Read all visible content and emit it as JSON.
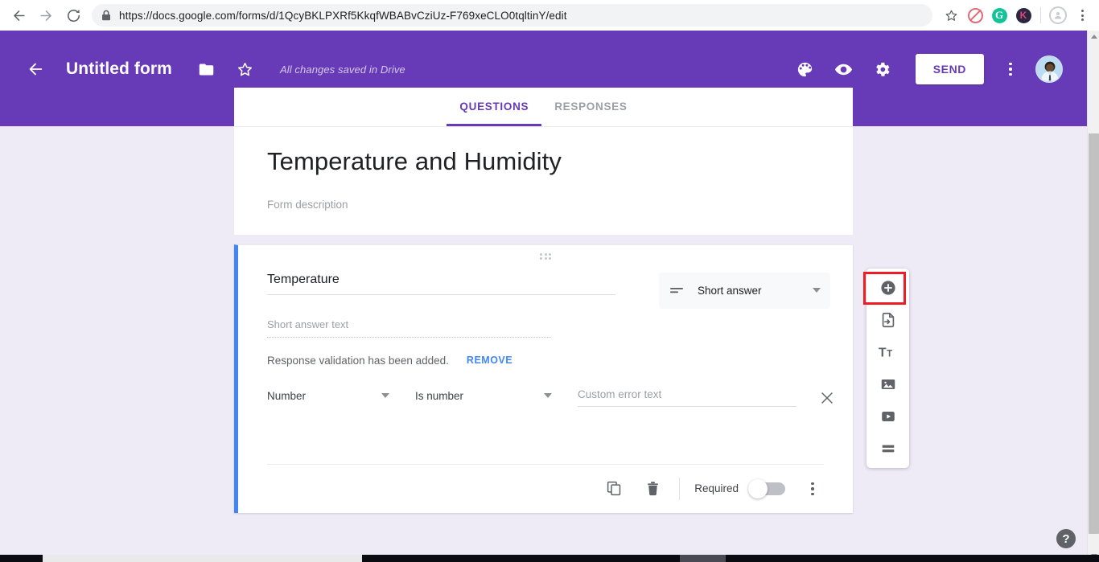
{
  "browser": {
    "url": "https://docs.google.com/forms/d/1QcyBKLPXRf5KkqfWBABvCziUz-F769xeCLO0tqltinY/edit",
    "url_domain": "docs.google.com",
    "url_path": "/forms/d/1QcyBKLPXRf5KkqfWBABvCziUz-F769xeCLO0tqltinY/edit",
    "back_icon": "back-arrow-icon",
    "forward_icon": "forward-arrow-icon",
    "reload_icon": "reload-icon",
    "lock_icon": "lock-icon",
    "bookmark_icon": "star-icon",
    "extensions": [
      {
        "name": "adblock-extension-icon",
        "label": ""
      },
      {
        "name": "grammarly-extension-icon",
        "label": "G"
      },
      {
        "name": "kami-extension-icon",
        "label": "K"
      }
    ],
    "profile_icon": "profile-icon",
    "menu_icon": "browser-menu-icon"
  },
  "header": {
    "back_icon": "back-arrow-icon",
    "title": "Untitled form",
    "folder_icon": "folder-icon",
    "star_icon": "star-icon",
    "save_status": "All changes saved in Drive",
    "theme_icon": "palette-icon",
    "preview_icon": "eye-icon",
    "settings_icon": "gear-icon",
    "send_label": "SEND",
    "more_icon": "more-vert-icon",
    "avatar": "user-avatar",
    "bg_color": "#673ab7"
  },
  "tabs": [
    {
      "label": "QUESTIONS",
      "active": true
    },
    {
      "label": "RESPONSES",
      "active": false
    }
  ],
  "form": {
    "title": "Temperature and Humidity",
    "description_placeholder": "Form description"
  },
  "question": {
    "drag_handle_icon": "drag-handle-icon",
    "title": "Temperature",
    "answer_placeholder": "Short answer text",
    "type_icon": "short-answer-icon",
    "type_label": "Short answer",
    "type_caret_icon": "chevron-down-icon",
    "validation": {
      "note": "Response validation has been added.",
      "remove_label": "REMOVE",
      "remove_color": "#4285f4",
      "criteria_type": "Number",
      "criteria_rule": "Is number",
      "error_placeholder": "Custom error text",
      "close_icon": "close-icon"
    },
    "footer": {
      "duplicate_icon": "duplicate-icon",
      "delete_icon": "trash-icon",
      "required_label": "Required",
      "required_on": false,
      "more_icon": "more-vert-icon"
    },
    "accent_color": "#4285f4"
  },
  "side_toolbar": {
    "items": [
      {
        "icon": "add-question-icon",
        "highlighted": true
      },
      {
        "icon": "import-questions-icon",
        "highlighted": false
      },
      {
        "icon": "add-title-description-icon",
        "highlighted": false
      },
      {
        "icon": "add-image-icon",
        "highlighted": false
      },
      {
        "icon": "add-video-icon",
        "highlighted": false
      },
      {
        "icon": "add-section-icon",
        "highlighted": false
      }
    ],
    "highlight_color": "#ee1c25"
  },
  "help": {
    "icon": "help-icon",
    "label": "?"
  },
  "scrollbar": {
    "up_icon": "scroll-up-icon",
    "down_icon": "scroll-down-icon"
  }
}
